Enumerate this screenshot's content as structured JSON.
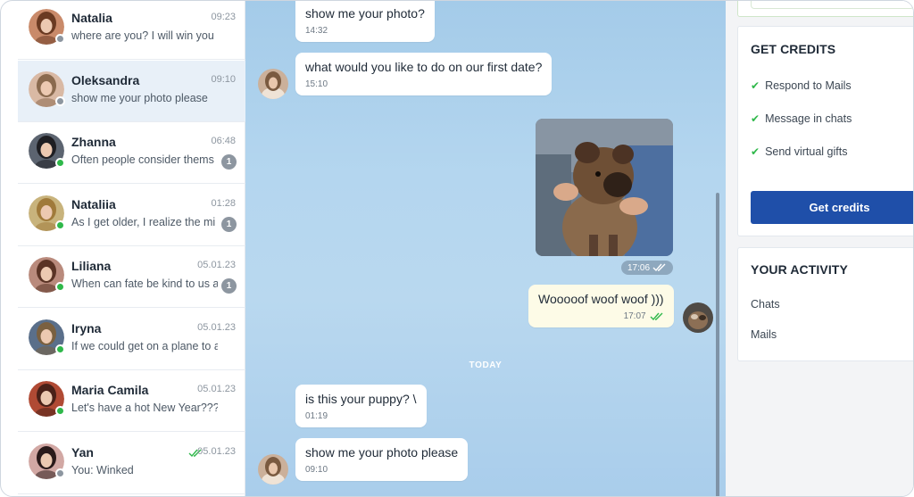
{
  "contacts": [
    {
      "name": "Natalia",
      "time": "09:23",
      "preview": "where are you? I will win you",
      "status": "offline",
      "unread": "",
      "active": false,
      "read": false,
      "avatar_color": "#c98a6a",
      "hair_color": "#6a3a22"
    },
    {
      "name": "Oleksandra",
      "time": "09:10",
      "preview": "show me your photo please",
      "status": "offline",
      "unread": "",
      "active": true,
      "read": false,
      "avatar_color": "#d9b9a4",
      "hair_color": "#8a6a4e"
    },
    {
      "name": "Zhanna",
      "time": "06:48",
      "preview": "Often people consider thems",
      "status": "online",
      "unread": "1",
      "active": false,
      "read": false,
      "avatar_color": "#5c6470",
      "hair_color": "#1e1e22"
    },
    {
      "name": "Nataliia",
      "time": "01:28",
      "preview": "As I get older, I realize the mi",
      "status": "online",
      "unread": "1",
      "active": false,
      "read": false,
      "avatar_color": "#c8b37c",
      "hair_color": "#a07a3a"
    },
    {
      "name": "Liliana",
      "time": "05.01.23",
      "preview": "When can fate be kind to us a",
      "status": "online",
      "unread": "1",
      "active": false,
      "read": false,
      "avatar_color": "#b98a7c",
      "hair_color": "#5a3325"
    },
    {
      "name": "Iryna",
      "time": "05.01.23",
      "preview": "If we could get on a plane to a",
      "status": "online",
      "unread": "",
      "active": false,
      "read": false,
      "avatar_color": "#5a6f8a",
      "hair_color": "#7a6040"
    },
    {
      "name": "Maria Camila",
      "time": "05.01.23",
      "preview": "Let's have a hot New Year???",
      "status": "online",
      "unread": "",
      "active": false,
      "read": false,
      "avatar_color": "#b04a34",
      "hair_color": "#4a2118"
    },
    {
      "name": "Yan",
      "time": "05.01.23",
      "preview": "You: Winked",
      "status": "offline",
      "unread": "",
      "active": false,
      "read": true,
      "avatar_color": "#d2a8a4",
      "hair_color": "#2a1a1a"
    }
  ],
  "messages": {
    "m1": {
      "text": "show me your photo?",
      "time": "14:32"
    },
    "m2": {
      "text": "what would you like to do on our first date?",
      "time": "15:10"
    },
    "photo": {
      "time": "17:06"
    },
    "m3": {
      "text": "Wooooof woof woof )))",
      "time": "17:07"
    },
    "day_divider": "TODAY",
    "m4": {
      "text": "is this your puppy? \\",
      "time": "01:19"
    },
    "m5": {
      "text": "show me your photo please",
      "time": "09:10"
    }
  },
  "credits_card": {
    "title": "GET CREDITS",
    "benefits": [
      "Respond to Mails",
      "Message in chats",
      "Send virtual gifts"
    ],
    "button_label": "Get credits"
  },
  "activity_card": {
    "title": "YOUR ACTIVITY",
    "links": [
      "Chats",
      "Mails"
    ]
  },
  "colors": {
    "accent": "#1f4fa9",
    "online": "#2fb84a",
    "offline": "#8d96a0",
    "active_row": "#e8f0f8",
    "own_bubble": "#fdfbe7"
  }
}
